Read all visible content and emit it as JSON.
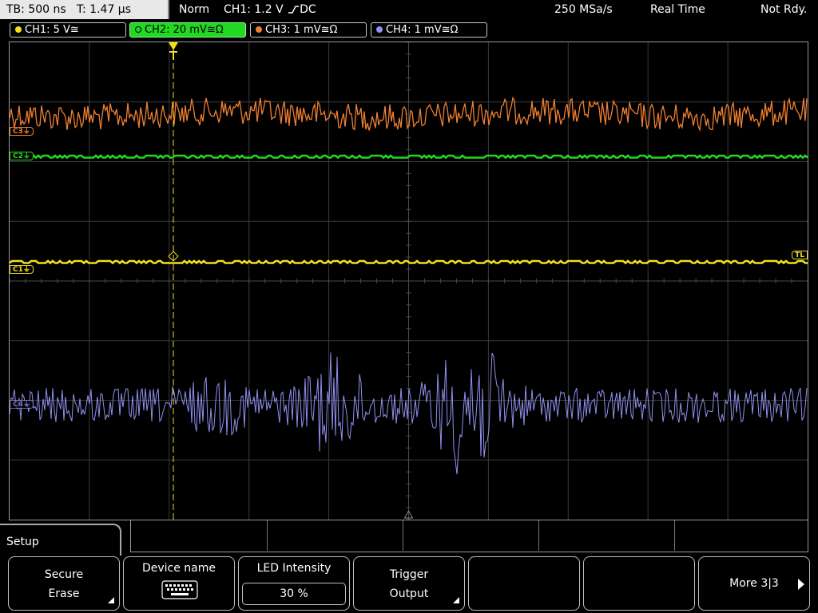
{
  "status_bar": {
    "timebase": "TB: 500 ns",
    "trigger_time": "T: 1.47 µs",
    "mode": "Norm",
    "trigger_info": "CH1: 1.2 V",
    "coupling": "DC",
    "sample_rate": "250 MSa/s",
    "acq_mode": "Real Time",
    "state": "Not Rdy."
  },
  "channels": [
    {
      "label": "CH1: 5 V≅",
      "color": "#f0e020"
    },
    {
      "label": "CH2: 20 mV≅Ω",
      "color": "#22d822"
    },
    {
      "label": "CH3: 1 mV≅Ω",
      "color": "#f08030"
    },
    {
      "label": "CH4: 1 mV≅Ω",
      "color": "#9090f0"
    }
  ],
  "markers": {
    "c3": "C3",
    "c2": "C2",
    "c1": "C1",
    "c4": "C4",
    "trigger_level": "TL"
  },
  "menu": {
    "title": "Setup",
    "softkeys": [
      {
        "line1": "Secure",
        "line2": "Erase"
      },
      {
        "line1": "Device name",
        "icon": "keyboard-icon"
      },
      {
        "line1": "LED Intensity",
        "value": "30 %"
      },
      {
        "line1": "Trigger",
        "line2": "Output"
      },
      {
        "line1": ""
      },
      {
        "line1": ""
      },
      {
        "line1": "More 3|3"
      }
    ]
  },
  "colors": {
    "ch1": "#f0e020",
    "ch2": "#22d822",
    "ch3": "#f08030",
    "ch4": "#9090f0",
    "grid": "#3a3a3a"
  }
}
